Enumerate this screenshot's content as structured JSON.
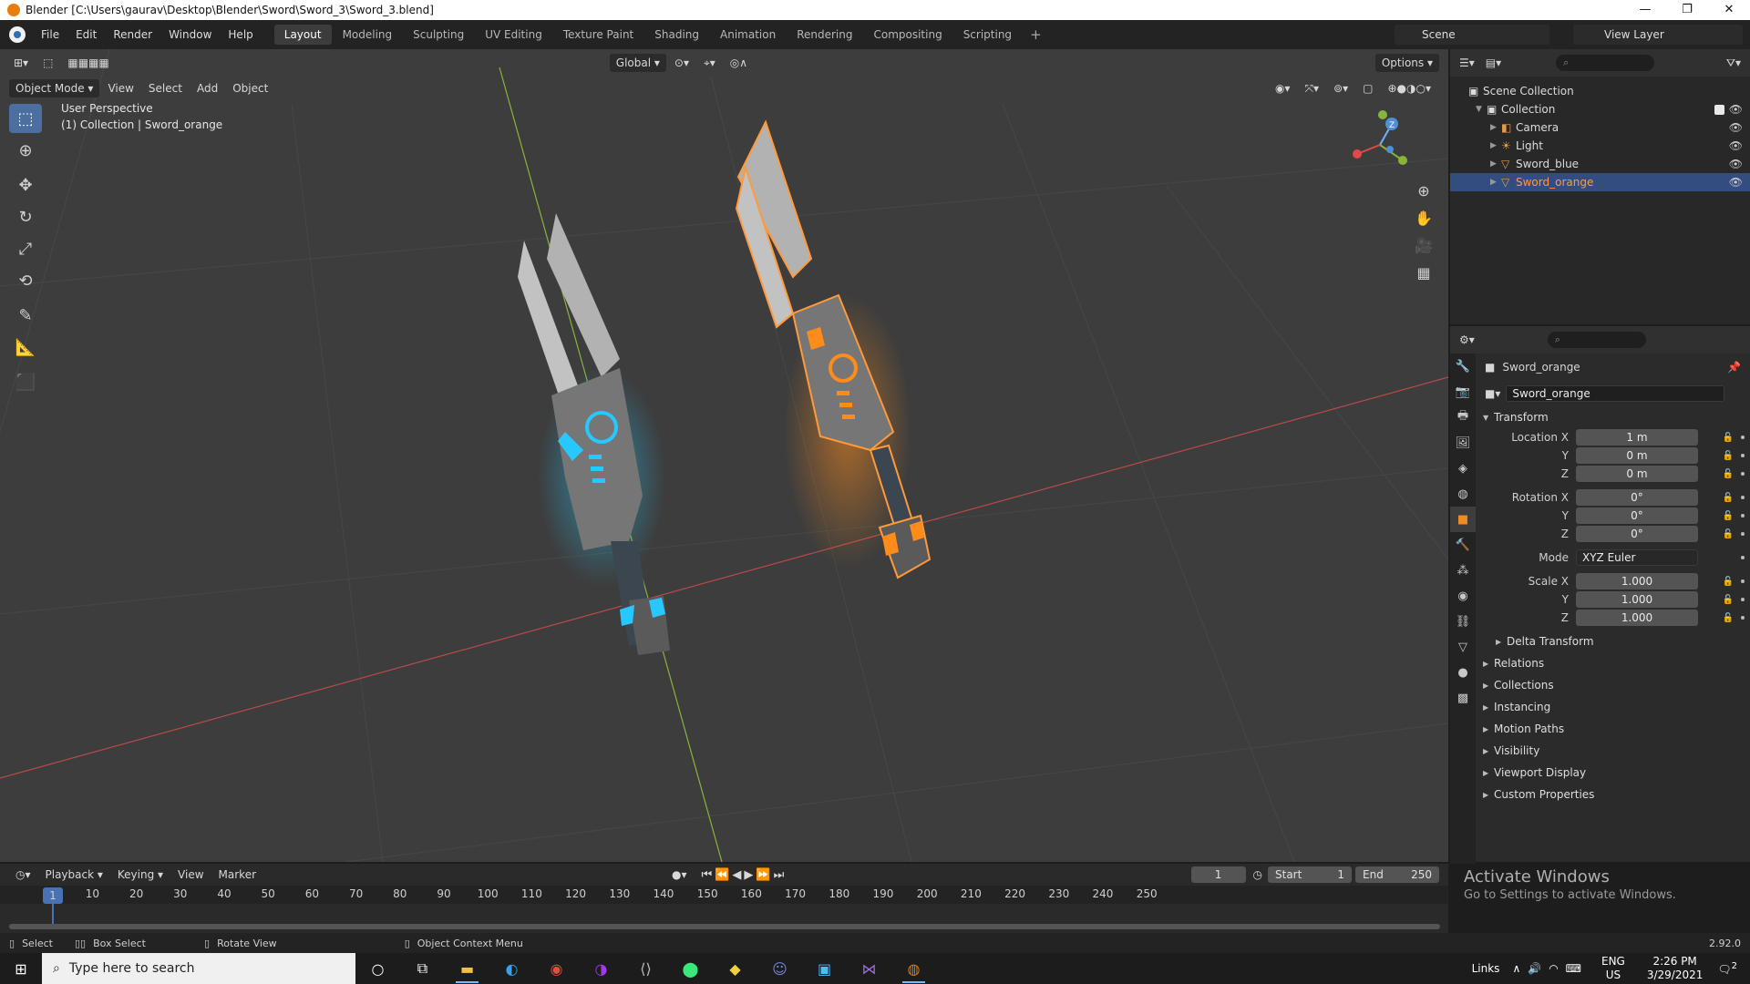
{
  "window": {
    "title": "Blender [C:\\Users\\gaurav\\Desktop\\Blender\\Sword\\Sword_3\\Sword_3.blend]"
  },
  "menubar": {
    "menus": [
      "File",
      "Edit",
      "Render",
      "Window",
      "Help"
    ],
    "workspaces": [
      "Layout",
      "Modeling",
      "Sculpting",
      "UV Editing",
      "Texture Paint",
      "Shading",
      "Animation",
      "Rendering",
      "Compositing",
      "Scripting"
    ],
    "active_workspace": "Layout",
    "scene": "Scene",
    "view_layer": "View Layer"
  },
  "viewport": {
    "mode": "Object Mode",
    "menus": [
      "View",
      "Select",
      "Add",
      "Object"
    ],
    "orientation": "Global",
    "options_label": "Options",
    "overlay_line1": "User Perspective",
    "overlay_line2": "(1) Collection | Sword_orange"
  },
  "outliner": {
    "root": "Scene Collection",
    "collection": "Collection",
    "items": [
      {
        "name": "Camera",
        "icon": "camera-icon"
      },
      {
        "name": "Light",
        "icon": "light-icon"
      },
      {
        "name": "Sword_blue",
        "icon": "mesh-icon"
      },
      {
        "name": "Sword_orange",
        "icon": "mesh-icon",
        "selected": true
      }
    ]
  },
  "properties": {
    "object_name": "Sword_orange",
    "datablock_name": "Sword_orange",
    "transform_label": "Transform",
    "location": {
      "label": "Location X",
      "x": "1 m",
      "y": "0 m",
      "z": "0 m"
    },
    "rotation": {
      "label": "Rotation X",
      "x": "0°",
      "y": "0°",
      "z": "0°"
    },
    "mode": {
      "label": "Mode",
      "value": "XYZ Euler"
    },
    "scale": {
      "label": "Scale X",
      "x": "1.000",
      "y": "1.000",
      "z": "1.000"
    },
    "axis_y": "Y",
    "axis_z": "Z",
    "delta_transform": "Delta Transform",
    "panels": [
      "Relations",
      "Collections",
      "Instancing",
      "Motion Paths",
      "Visibility",
      "Viewport Display",
      "Custom Properties"
    ]
  },
  "activate_windows": {
    "title": "Activate Windows",
    "subtitle": "Go to Settings to activate Windows."
  },
  "timeline": {
    "menus": [
      "Playback",
      "Keying",
      "View",
      "Marker"
    ],
    "current_frame": "1",
    "start_label": "Start",
    "start": "1",
    "end_label": "End",
    "end": "250",
    "frame_ticks": [
      "10",
      "20",
      "30",
      "40",
      "50",
      "60",
      "70",
      "80",
      "90",
      "100",
      "110",
      "120",
      "130",
      "140",
      "150",
      "160",
      "170",
      "180",
      "190",
      "200",
      "210",
      "220",
      "230",
      "240",
      "250"
    ]
  },
  "statusbar": {
    "select": "Select",
    "box_select": "Box Select",
    "rotate_view": "Rotate View",
    "context_menu": "Object Context Menu",
    "version": "2.92.0"
  },
  "taskbar": {
    "search_placeholder": "Type here to search",
    "links": "Links",
    "lang1": "ENG",
    "lang2": "US",
    "time": "2:26 PM",
    "date": "3/29/2021",
    "notifications": "2"
  },
  "colors": {
    "accent_blue": "#4772b3",
    "selection_orange": "#ff9a3c",
    "glow_cyan": "#27c8ff",
    "glow_orange": "#ff8c1a"
  }
}
